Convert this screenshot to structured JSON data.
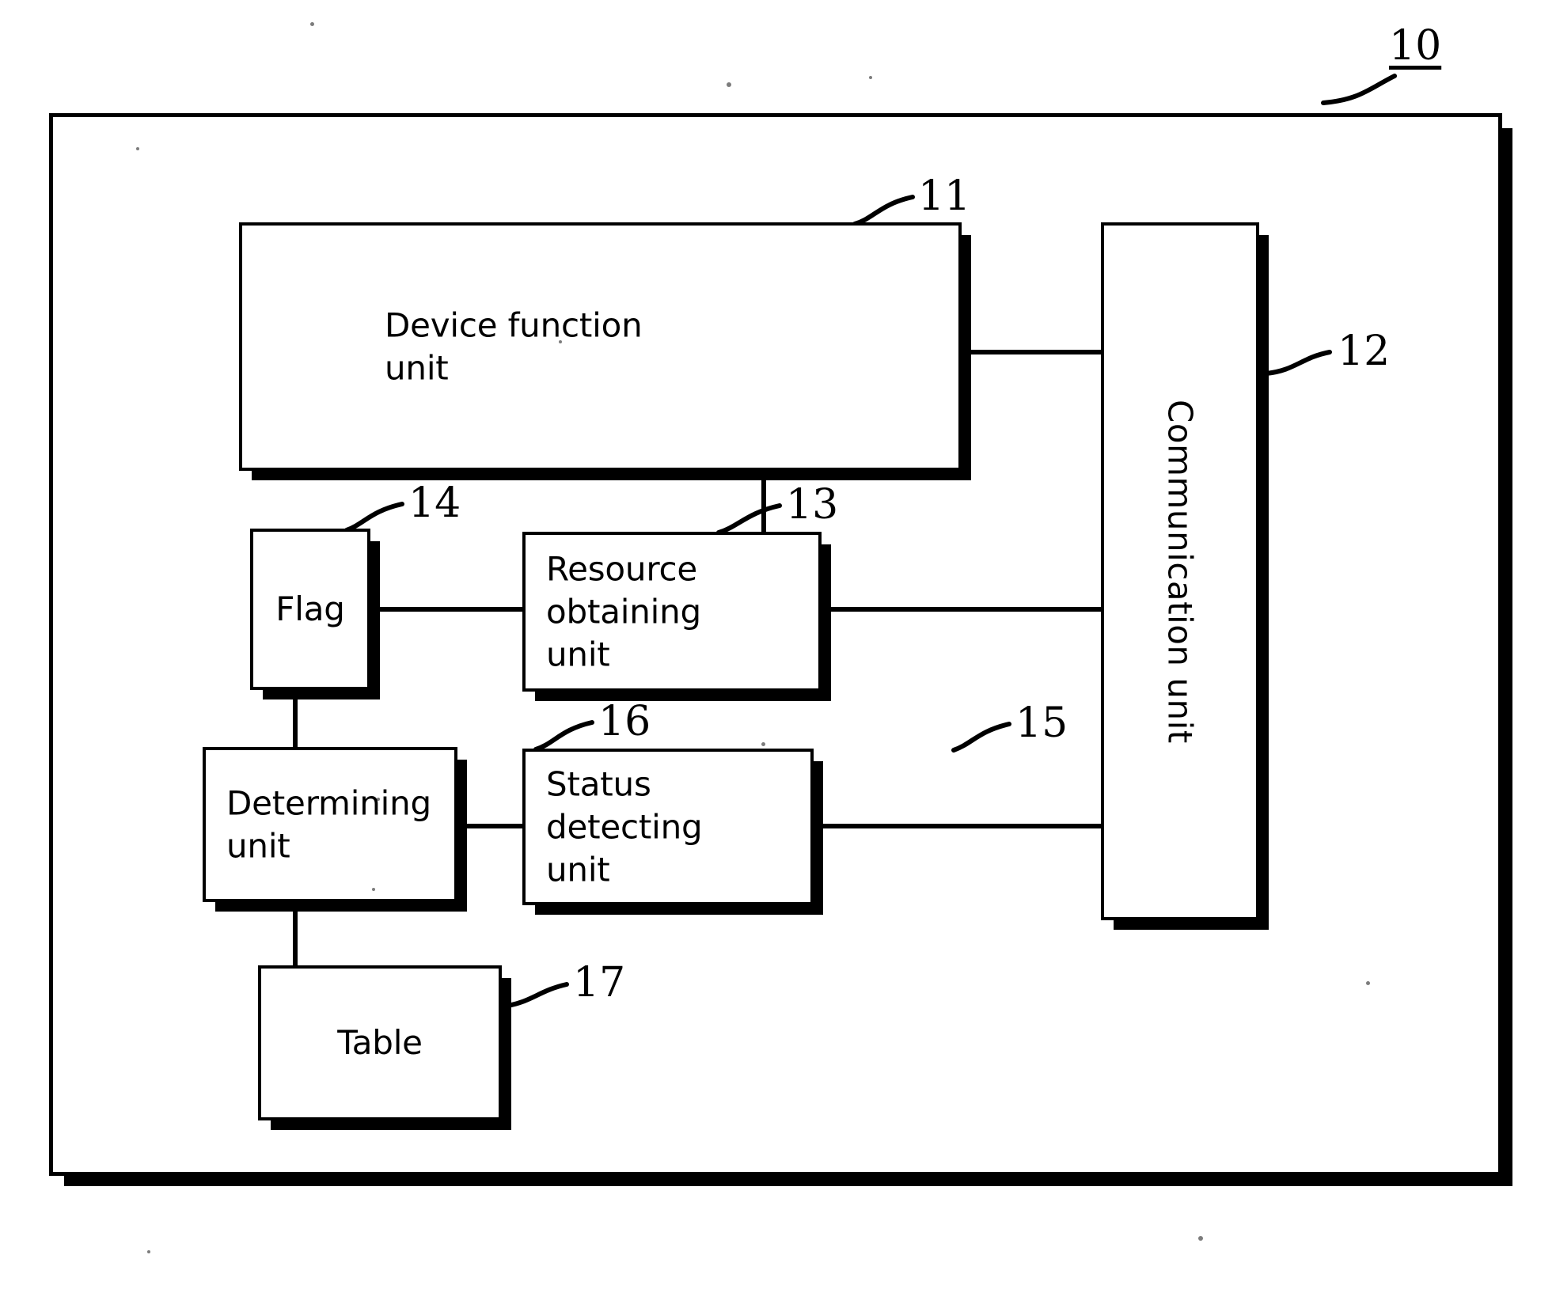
{
  "figure": {
    "type": "patent-block-diagram",
    "enclosure_label": "10",
    "blocks": [
      {
        "id": "device-function-unit",
        "label": "Device function\nunit",
        "ref": "11"
      },
      {
        "id": "communication-unit",
        "label": "Communication unit",
        "ref": "12"
      },
      {
        "id": "resource-obtaining-unit",
        "label": "Resource obtaining\nunit",
        "ref": "13"
      },
      {
        "id": "flag",
        "label": "Flag",
        "ref": "14"
      },
      {
        "id": "status-detecting-unit",
        "label": "Status detecting\nunit",
        "ref": "15"
      },
      {
        "id": "determining-unit",
        "label": "Determining unit",
        "ref": "16"
      },
      {
        "id": "table",
        "label": "Table",
        "ref": "17"
      }
    ],
    "connections": [
      {
        "from": "device-function-unit",
        "to": "communication-unit"
      },
      {
        "from": "device-function-unit",
        "to": "resource-obtaining-unit"
      },
      {
        "from": "flag",
        "to": "resource-obtaining-unit"
      },
      {
        "from": "resource-obtaining-unit",
        "to": "communication-unit"
      },
      {
        "from": "flag",
        "to": "determining-unit"
      },
      {
        "from": "determining-unit",
        "to": "status-detecting-unit"
      },
      {
        "from": "status-detecting-unit",
        "to": "communication-unit"
      },
      {
        "from": "determining-unit",
        "to": "table"
      }
    ],
    "colors": {
      "stroke": "#000000",
      "fill": "#ffffff",
      "background": "#ffffff"
    }
  }
}
